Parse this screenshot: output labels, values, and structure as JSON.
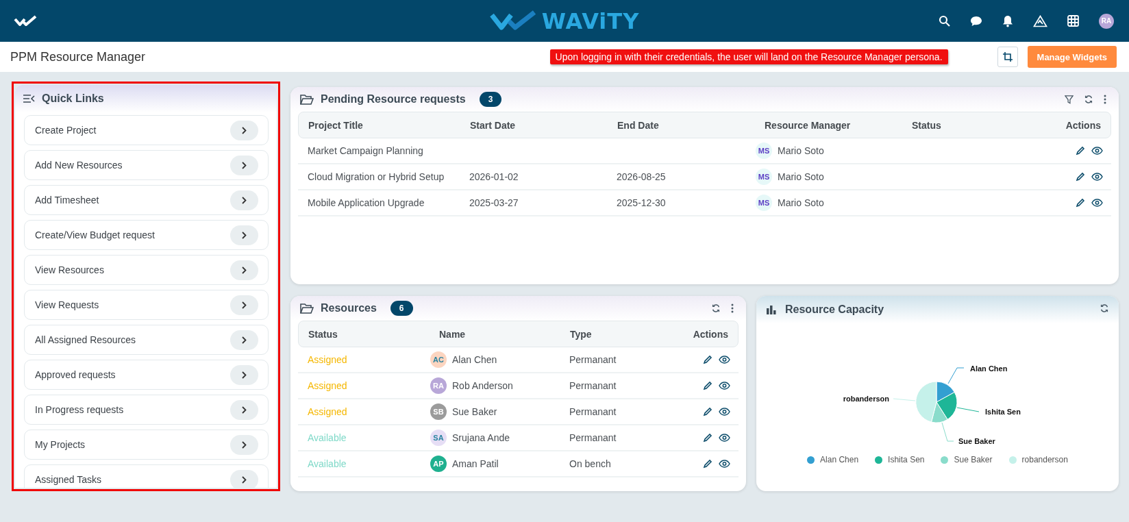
{
  "header": {
    "logo_text": "WAViTY",
    "user_initials": "RA"
  },
  "page": {
    "title": "PPM Resource Manager",
    "annotation": "Upon logging in with their credentials, the user will land on the Resource Manager persona.",
    "manage_button": "Manage Widgets"
  },
  "quick_links": {
    "title": "Quick Links",
    "highlighted": true,
    "items": [
      {
        "label": "Create Project"
      },
      {
        "label": "Add New Resources"
      },
      {
        "label": "Add Timesheet"
      },
      {
        "label": "Create/View Budget request"
      },
      {
        "label": "View Resources"
      },
      {
        "label": "View Requests"
      },
      {
        "label": "All Assigned Resources"
      },
      {
        "label": "Approved requests"
      },
      {
        "label": "In Progress requests"
      },
      {
        "label": "My Projects"
      },
      {
        "label": "Assigned Tasks"
      }
    ]
  },
  "pending": {
    "title": "Pending Resource requests",
    "count": "3",
    "columns": [
      "Project Title",
      "Start Date",
      "End Date",
      "Resource Manager",
      "Status",
      "Actions"
    ],
    "rows": [
      {
        "project_title": "Market Campaign Planning",
        "manager": {
          "initials": "MS",
          "name": "Mario Soto",
          "color": "#e6f8f8"
        }
      },
      {
        "project_title": "Cloud Migration or Hybrid Setup",
        "start_date": "2026-01-02",
        "end_date": "2026-08-25",
        "manager": {
          "initials": "MS",
          "name": "Mario Soto",
          "color": "#e6f8f8"
        }
      },
      {
        "project_title": "Mobile Application Upgrade",
        "start_date": "2025-03-27",
        "end_date": "2025-12-30",
        "manager": {
          "initials": "MS",
          "name": "Mario Soto",
          "color": "#e6f8f8"
        }
      }
    ]
  },
  "resources": {
    "title": "Resources",
    "count": "6",
    "columns": [
      "Status",
      "Name",
      "Type",
      "Actions"
    ],
    "rows": [
      {
        "status": {
          "text": "Assigned",
          "color": "#f5b700"
        },
        "avatar": {
          "initials": "AC",
          "color": "#fcd5c0"
        },
        "name": "Alan Chen",
        "type": "Permanant"
      },
      {
        "status": {
          "text": "Assigned",
          "color": "#f5b700"
        },
        "avatar": {
          "initials": "RA",
          "color": "#b8a7d8"
        },
        "name": "Rob Anderson",
        "type": "Permanant"
      },
      {
        "status": {
          "text": "Assigned",
          "color": "#f5b700"
        },
        "avatar": {
          "initials": "SB",
          "color": "#9b9b9b"
        },
        "name": "Sue Baker",
        "type": "Permanant"
      },
      {
        "status": {
          "text": "Available",
          "color": "#7fd9c8"
        },
        "avatar": {
          "initials": "SA",
          "color": "#e6def5"
        },
        "name": "Srujana Ande",
        "type": "Permanant"
      },
      {
        "status": {
          "text": "Available",
          "color": "#7fd9c8"
        },
        "avatar": {
          "initials": "AP",
          "color": "#1fb08f"
        },
        "name": "Aman Patil",
        "type": "On bench"
      }
    ]
  },
  "capacity": {
    "title": "Resource Capacity",
    "pie_labels": [
      "Alan Chen",
      "Ishita Sen",
      "Sue Baker",
      "robanderson"
    ],
    "legend": [
      {
        "label": "Alan Chen",
        "color": "#339fd1"
      },
      {
        "label": "Ishita Sen",
        "color": "#1eb697"
      },
      {
        "label": "Sue Baker",
        "color": "#8adccb"
      },
      {
        "label": "robanderson",
        "color": "#c5f1ea"
      }
    ]
  }
}
